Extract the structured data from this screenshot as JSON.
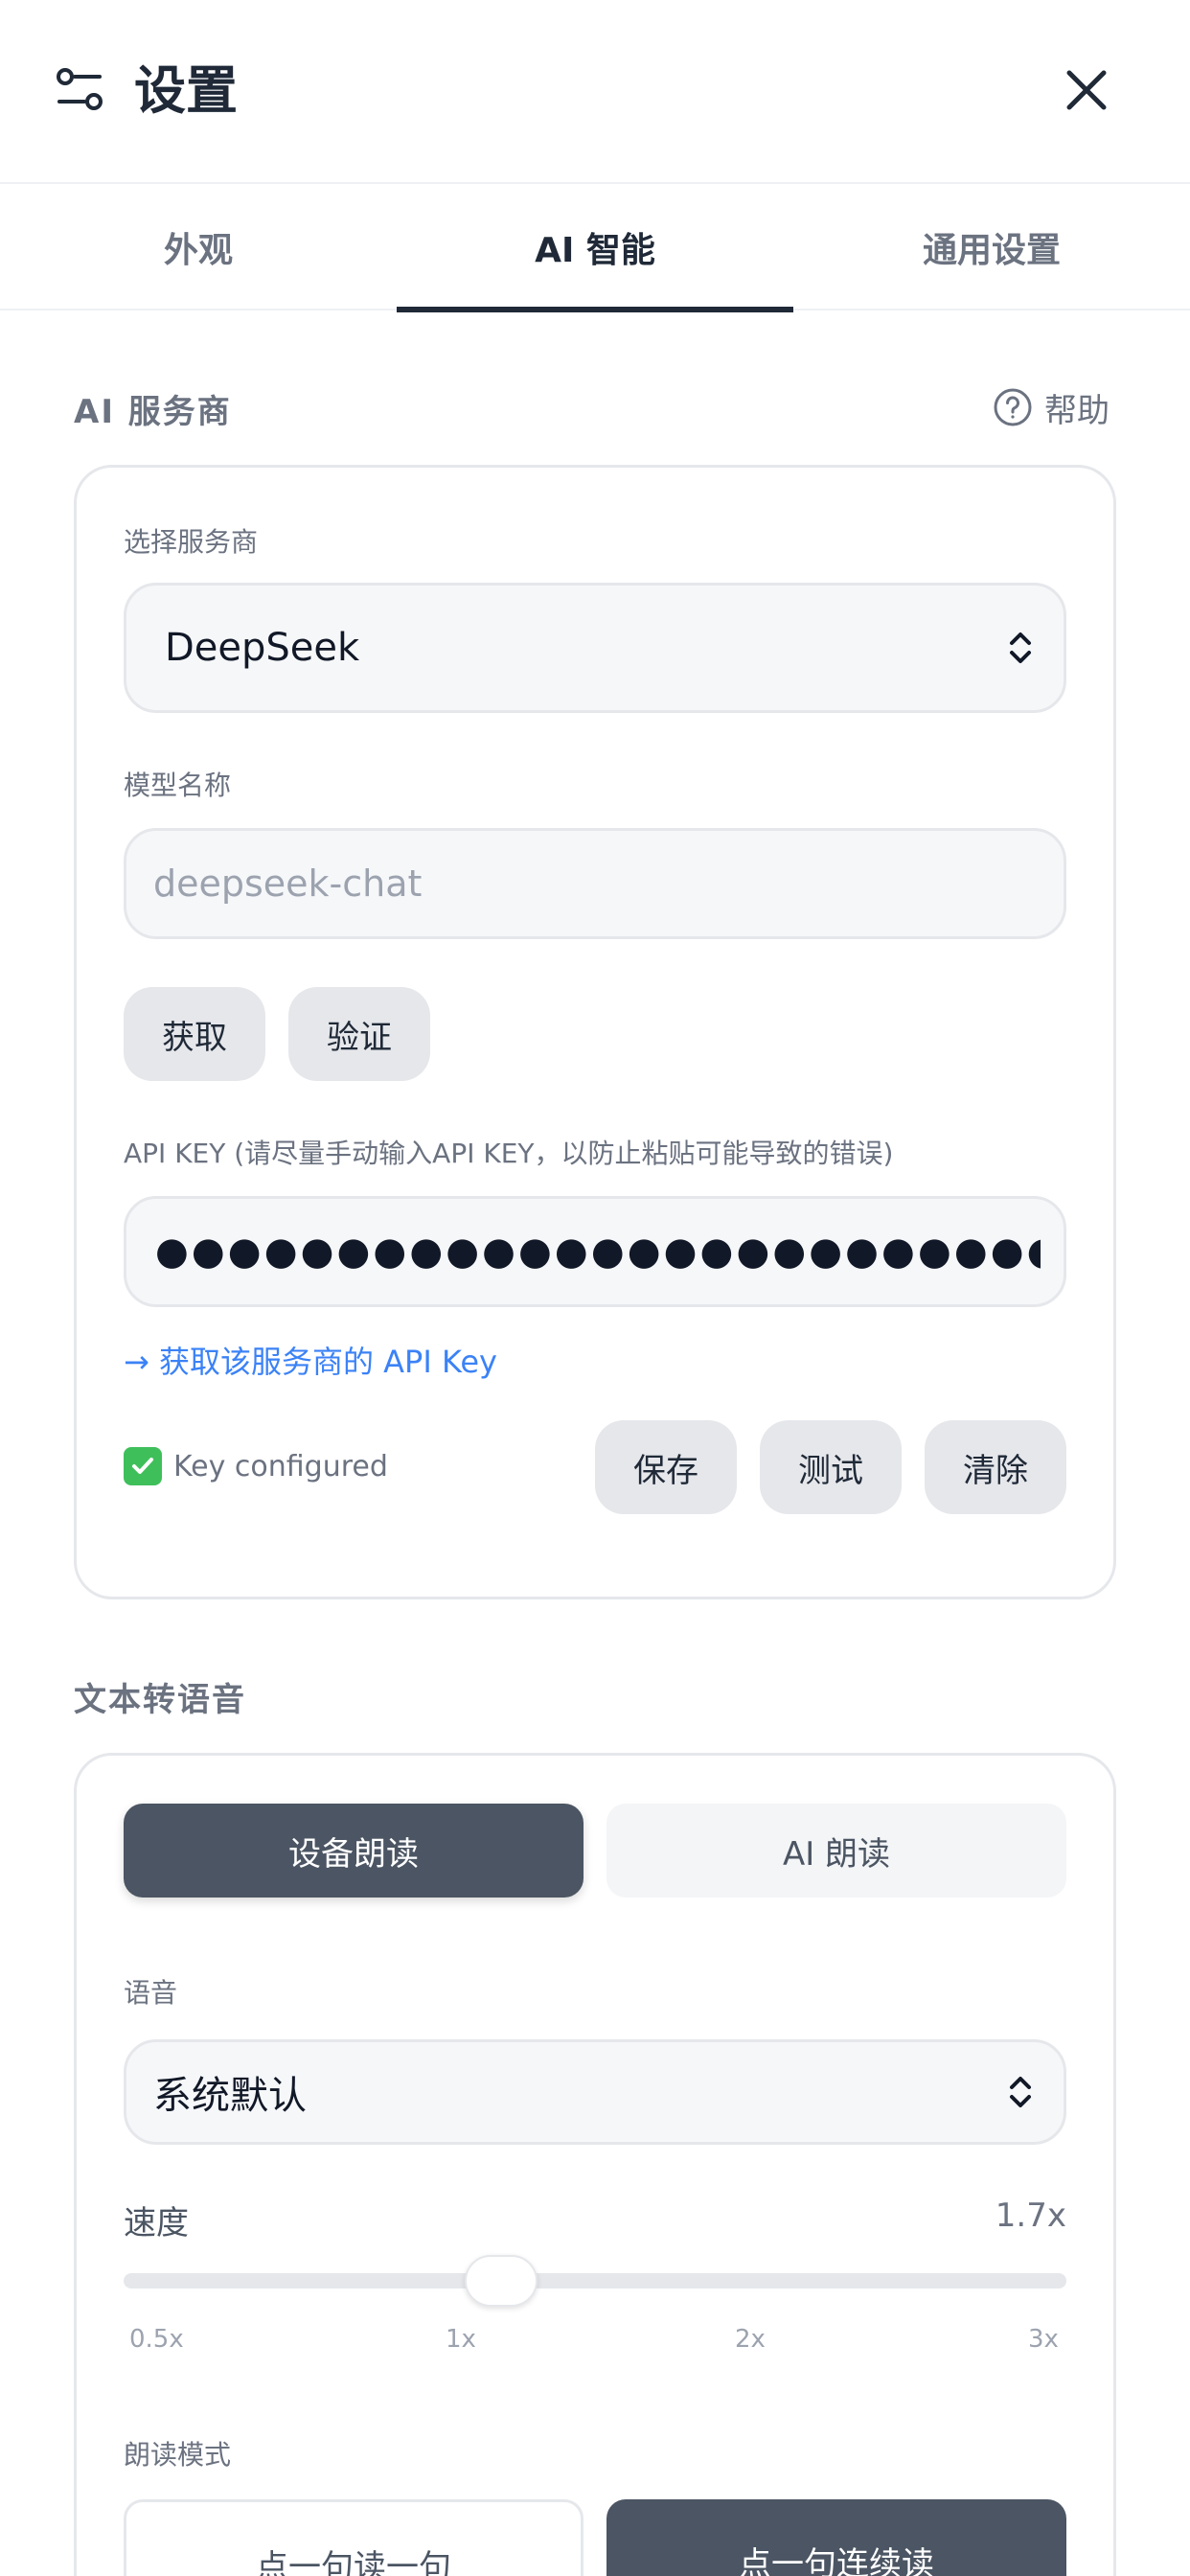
{
  "header": {
    "title": "设置"
  },
  "tabs": [
    {
      "label": "外观"
    },
    {
      "label": "AI 智能"
    },
    {
      "label": "通用设置"
    }
  ],
  "ai_section": {
    "title": "AI 服务商",
    "help_label": "帮助",
    "provider_label": "选择服务商",
    "provider_value": "DeepSeek",
    "model_label": "模型名称",
    "model_placeholder": "deepseek-chat",
    "fetch_label": "获取",
    "verify_label": "验证",
    "api_key_label": "API KEY (请尽量手动输入API KEY，以防止粘贴可能导致的错误)",
    "api_key_masked": "●●●●●●●●●●●●●●●●●●●●●●●●●●●●●●●●●●●",
    "get_key_link": "→ 获取该服务商的 API Key",
    "status_text": "Key configured",
    "save_label": "保存",
    "test_label": "测试",
    "clear_label": "清除"
  },
  "tts_section": {
    "title": "文本转语音",
    "device_read_label": "设备朗读",
    "ai_read_label": "AI 朗读",
    "voice_label": "语音",
    "voice_value": "系统默认",
    "speed_label": "速度",
    "speed_value": "1.7x",
    "speed_ratio": 0.4,
    "ticks": [
      "0.5x",
      "1x",
      "2x",
      "3x"
    ],
    "read_mode_label": "朗读模式",
    "mode_single_label": "点一句读一句",
    "mode_continuous_label": "点一句连续读"
  },
  "colors": {
    "accent": "#1f2937",
    "link": "#3b82f6",
    "segment_active": "#4b5563",
    "check_green": "#3fbf5a"
  }
}
